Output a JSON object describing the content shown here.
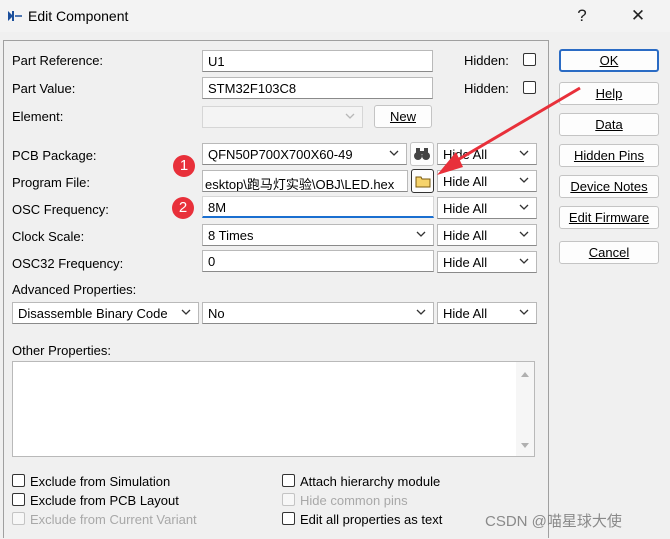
{
  "window": {
    "title": "Edit Component",
    "help": "?",
    "close": "✕"
  },
  "fields": {
    "part_reference": {
      "label": "Part Reference:",
      "value": "U1",
      "hidden_label": "Hidden:"
    },
    "part_value": {
      "label": "Part Value:",
      "value": "STM32F103C8",
      "hidden_label": "Hidden:"
    },
    "element": {
      "label": "Element:",
      "value": "",
      "new_button": "New"
    },
    "pcb_package": {
      "label": "PCB Package:",
      "value": "QFN50P700X700X60-49",
      "hide": "Hide All"
    },
    "program_file": {
      "label": "Program File:",
      "value": "esktop\\跑马灯实验\\OBJ\\LED.hex",
      "hide": "Hide All"
    },
    "osc_frequency": {
      "label": "OSC Frequency:",
      "value": "8M",
      "hide": "Hide All"
    },
    "clock_scale": {
      "label": "Clock Scale:",
      "value": "8 Times",
      "hide": "Hide All"
    },
    "osc32_frequency": {
      "label": "OSC32 Frequency:",
      "value": "0",
      "hide": "Hide All"
    },
    "advanced": {
      "label": "Advanced Properties:",
      "property": "Disassemble Binary Code",
      "value": "No",
      "hide": "Hide All"
    },
    "other": {
      "label": "Other Properties:"
    }
  },
  "checkboxes": {
    "exclude_simulation": "Exclude from Simulation",
    "exclude_pcb": "Exclude from PCB Layout",
    "exclude_variant": "Exclude from Current Variant",
    "attach_hierarchy": "Attach hierarchy module",
    "hide_common_pins": "Hide common pins",
    "edit_all_text": "Edit all properties as text"
  },
  "buttons": {
    "ok": "OK",
    "help": "Help",
    "data": "Data",
    "hidden_pins": "Hidden Pins",
    "device_notes": "Device Notes",
    "edit_firmware": "Edit Firmware",
    "cancel": "Cancel"
  },
  "annotations": {
    "badge1": "1",
    "badge2": "2",
    "arrow_color": "#e8303a"
  },
  "watermark": "CSDN @喵星球大使"
}
